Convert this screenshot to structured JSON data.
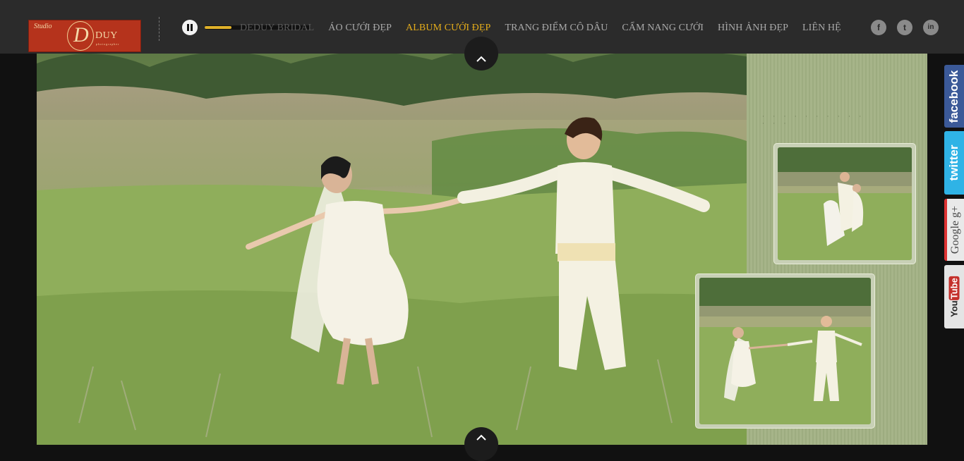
{
  "header": {
    "logo": {
      "studio": "Studio",
      "monogram": "D",
      "name": "DUY",
      "tagline": "photographer"
    },
    "player": {
      "state": "playing",
      "progress": 0.25
    },
    "nav": [
      {
        "label": "DEDUY BRIDAL",
        "active": false
      },
      {
        "label": "ÁO CƯỚI ĐẸP",
        "active": false
      },
      {
        "label": "ALBUM CƯỚI ĐẸP",
        "active": true
      },
      {
        "label": "TRANG ĐIỂM CÔ DÂU",
        "active": false
      },
      {
        "label": "CẨM NANG CƯỚI",
        "active": false
      },
      {
        "label": "HÌNH ẢNH ĐẸP",
        "active": false
      },
      {
        "label": "LIÊN HỆ",
        "active": false
      }
    ],
    "social": [
      {
        "icon": "facebook-icon",
        "glyph": "f"
      },
      {
        "icon": "twitter-icon",
        "glyph": "t"
      },
      {
        "icon": "linkedin-icon",
        "glyph": "in"
      }
    ]
  },
  "share_tabs": {
    "facebook": "facebook",
    "twitter": "twitter",
    "google": "Google g+",
    "youtube_pre": "You",
    "youtube_tube": "Tube"
  },
  "album": {
    "side_text": "· · · · · · ·   · ·   · · · ·",
    "colors": {
      "panel": "#a6b489",
      "grass": "#7e9f4f",
      "accent": "#e4ac1b"
    }
  }
}
